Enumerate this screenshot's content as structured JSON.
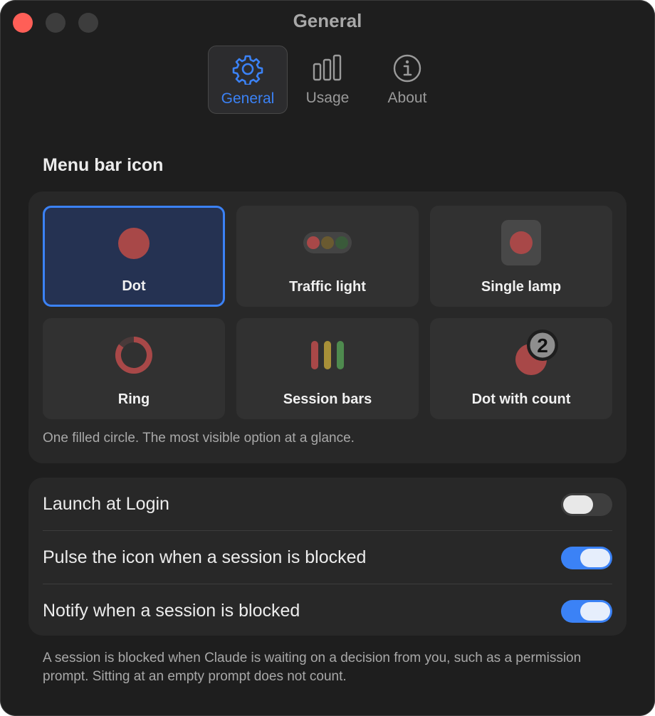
{
  "window": {
    "title": "General"
  },
  "tabs": [
    {
      "label": "General",
      "icon": "gear-icon",
      "active": true
    },
    {
      "label": "Usage",
      "icon": "bar-chart-icon",
      "active": false
    },
    {
      "label": "About",
      "icon": "info-icon",
      "active": false
    }
  ],
  "menu_bar_icon": {
    "title": "Menu bar icon",
    "options": [
      {
        "label": "Dot",
        "icon": "dot-icon",
        "selected": true
      },
      {
        "label": "Traffic light",
        "icon": "traffic-light-icon",
        "selected": false
      },
      {
        "label": "Single lamp",
        "icon": "single-lamp-icon",
        "selected": false
      },
      {
        "label": "Ring",
        "icon": "ring-icon",
        "selected": false
      },
      {
        "label": "Session bars",
        "icon": "session-bars-icon",
        "selected": false
      },
      {
        "label": "Dot with count",
        "icon": "dot-with-count-icon",
        "selected": false,
        "count": "2"
      }
    ],
    "description": "One filled circle. The most visible option at a glance."
  },
  "settings": [
    {
      "label": "Launch at Login",
      "enabled": false
    },
    {
      "label": "Pulse the icon when a session is blocked",
      "enabled": true
    },
    {
      "label": "Notify when a session is blocked",
      "enabled": true
    }
  ],
  "footnote": "A session is blocked when Claude is waiting on a decision from you, such as a permission prompt. Sitting at an empty prompt does not count.",
  "colors": {
    "accent": "#3b82f6",
    "status_red": "#a84848",
    "status_yellow": "#a89038",
    "status_green": "#4e8a4e"
  }
}
